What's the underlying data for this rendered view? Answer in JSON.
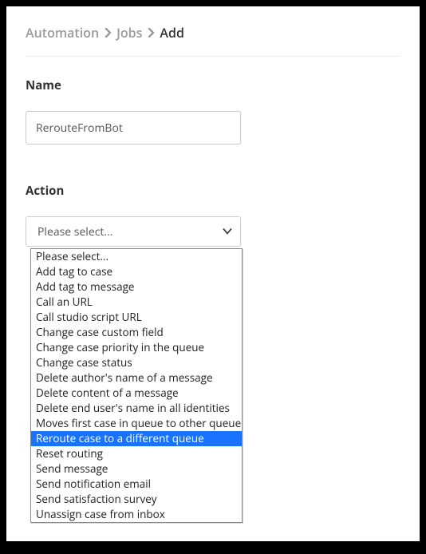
{
  "breadcrumb": {
    "item0": "Automation",
    "item1": "Jobs",
    "item2": "Add"
  },
  "name": {
    "label": "Name",
    "value": "RerouteFromBot"
  },
  "action": {
    "label": "Action",
    "placeholder": "Please select...",
    "selected_index": 12,
    "options": [
      "Please select...",
      "Add tag to case",
      "Add tag to message",
      "Call an URL",
      "Call studio script URL",
      "Change case custom field",
      "Change case priority in the queue",
      "Change case status",
      "Delete author's name of a message",
      "Delete content of a message",
      "Delete end user's name in all identities",
      "Moves first case in queue to other queue",
      "Reroute case to a different queue",
      "Reset routing",
      "Send message",
      "Send notification email",
      "Send satisfaction survey",
      "Unassign case from inbox"
    ]
  }
}
